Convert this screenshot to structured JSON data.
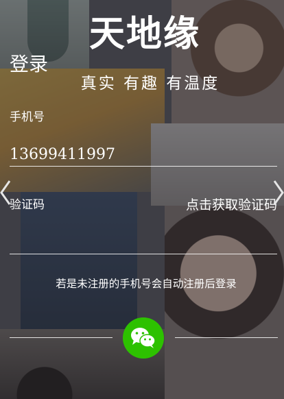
{
  "brand": {
    "title": "天地缘",
    "slogan": "真实 有趣 有温度"
  },
  "login": {
    "title": "登录",
    "phone_label": "手机号",
    "phone_value": "13699411997",
    "code_label": "验证码",
    "code_value": "",
    "get_code_label": "点击获取验证码",
    "notice": "若是未注册的手机号会自动注册后登录"
  },
  "social": {
    "wechat_icon": "wechat-icon",
    "wechat_color": "#2dc100"
  },
  "carousel": {
    "prev_icon": "chevron-left-icon",
    "next_icon": "chevron-right-icon"
  }
}
